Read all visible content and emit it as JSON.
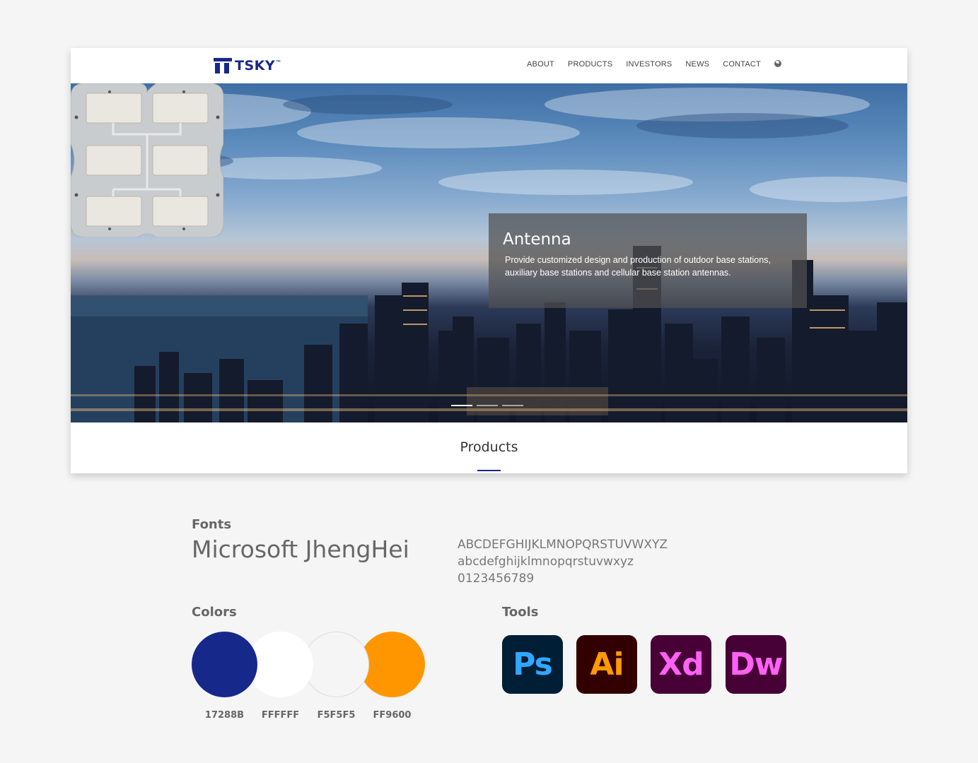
{
  "site": {
    "logo_text": "TSKY",
    "logo_tm": "™",
    "nav": [
      "ABOUT",
      "PRODUCTS",
      "INVESTORS",
      "NEWS",
      "CONTACT"
    ]
  },
  "hero": {
    "title": "Antenna",
    "description": "Provide customized design and production of outdoor base stations, auxiliary base stations and cellular base station antennas."
  },
  "products_heading": "Products",
  "fonts": {
    "heading": "Fonts",
    "name": "Microsoft JhengHei",
    "uppercase": "ABCDEFGHIJKLMNOPQRSTUVWXYZ",
    "lowercase": "abcdefghijklmnopqrstuvwxyz",
    "digits": "0123456789"
  },
  "colors": {
    "heading": "Colors",
    "swatches": [
      {
        "label": "17288B",
        "hex": "#17288B"
      },
      {
        "label": "FFFFFF",
        "hex": "#FFFFFF"
      },
      {
        "label": "F5F5F5",
        "hex": "#F5F5F5"
      },
      {
        "label": "FF9600",
        "hex": "#FF9600"
      }
    ]
  },
  "tools": {
    "heading": "Tools",
    "items": [
      {
        "label": "Ps",
        "bg": "#001E36",
        "fg": "#31A8FF"
      },
      {
        "label": "Ai",
        "bg": "#330000",
        "fg": "#FF9A00"
      },
      {
        "label": "Xd",
        "bg": "#470137",
        "fg": "#FF61F6"
      },
      {
        "label": "Dw",
        "bg": "#470137",
        "fg": "#FF61F6"
      }
    ]
  }
}
